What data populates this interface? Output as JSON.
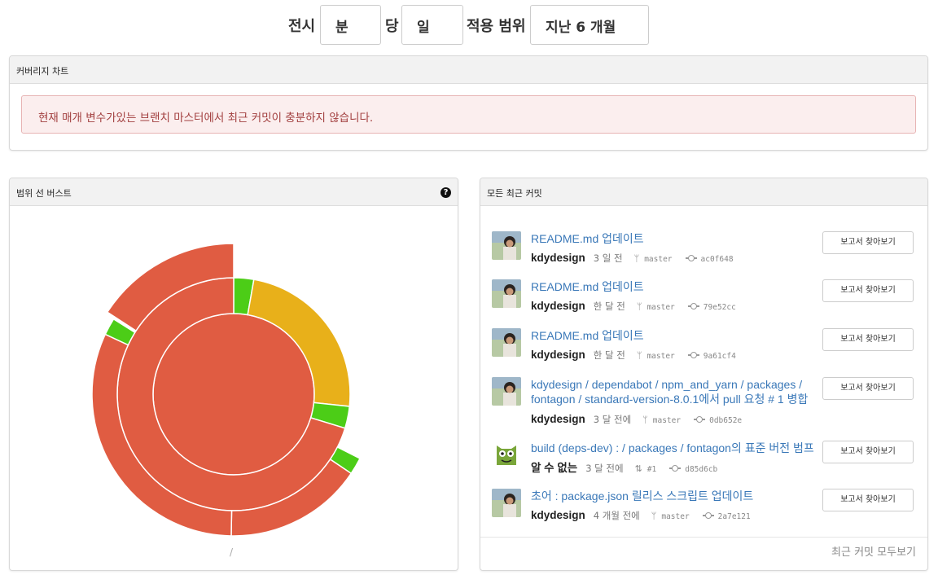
{
  "filter": {
    "display_label": "전시",
    "unit_value": "분",
    "per_label": "당",
    "per_value": "일",
    "scope_label": "적용 범위",
    "scope_value": "지난 6 개월"
  },
  "coverage_panel": {
    "title": "커버리지 차트",
    "alert_text": "현재 매개 변수가있는 브랜치 마스터에서 최근 커밋이 충분하지 않습니다."
  },
  "sunburst_panel": {
    "title": "범위 선 버스트",
    "help_icon": "question-circle-icon",
    "root_label": "/",
    "colors": {
      "red": "#e05c42",
      "yellow": "#e8b01a",
      "green": "#4ccd17"
    }
  },
  "commits_panel": {
    "title": "모든 최근 커밋",
    "see_all": "최근 커밋 모두보기",
    "commits": [
      {
        "title": "README.md 업데이트",
        "author": "kdydesign",
        "when": "3 일 전",
        "ref_icon": "branch-icon",
        "ref": "master",
        "sha": "ac0f648",
        "button": "보고서 찾아보기",
        "avatar": "photo"
      },
      {
        "title": "README.md 업데이트",
        "author": "kdydesign",
        "when": "한 달 전",
        "ref_icon": "branch-icon",
        "ref": "master",
        "sha": "79e52cc",
        "button": "보고서 찾아보기",
        "avatar": "photo"
      },
      {
        "title": "README.md 업데이트",
        "author": "kdydesign",
        "when": "한 달 전",
        "ref_icon": "branch-icon",
        "ref": "master",
        "sha": "9a61cf4",
        "button": "보고서 찾아보기",
        "avatar": "photo"
      },
      {
        "title": "kdydesign / dependabot / npm_and_yarn / packages / fontagon / standard-version-8.0.1에서 pull 요청 # 1 병합",
        "author": "kdydesign",
        "when": "3 달 전에",
        "ref_icon": "branch-icon",
        "ref": "master",
        "sha": "0db652e",
        "button": "보고서 찾아보기",
        "avatar": "photo"
      },
      {
        "title": "build (deps-dev) : / packages / fontagon의 표준 버전 범프",
        "author": "알 수 없는",
        "when": "3 달 전에",
        "ref_icon": "pull-request-icon",
        "ref": "#1",
        "sha": "d85d6cb",
        "button": "보고서 찾아보기",
        "avatar": "bot"
      },
      {
        "title": "초어 : package.json 릴리스 스크립트 업데이트",
        "author": "kdydesign",
        "when": "4 개월 전에",
        "ref_icon": "branch-icon",
        "ref": "master",
        "sha": "2a7e121",
        "button": "보고서 찾아보기",
        "avatar": "photo"
      }
    ]
  }
}
